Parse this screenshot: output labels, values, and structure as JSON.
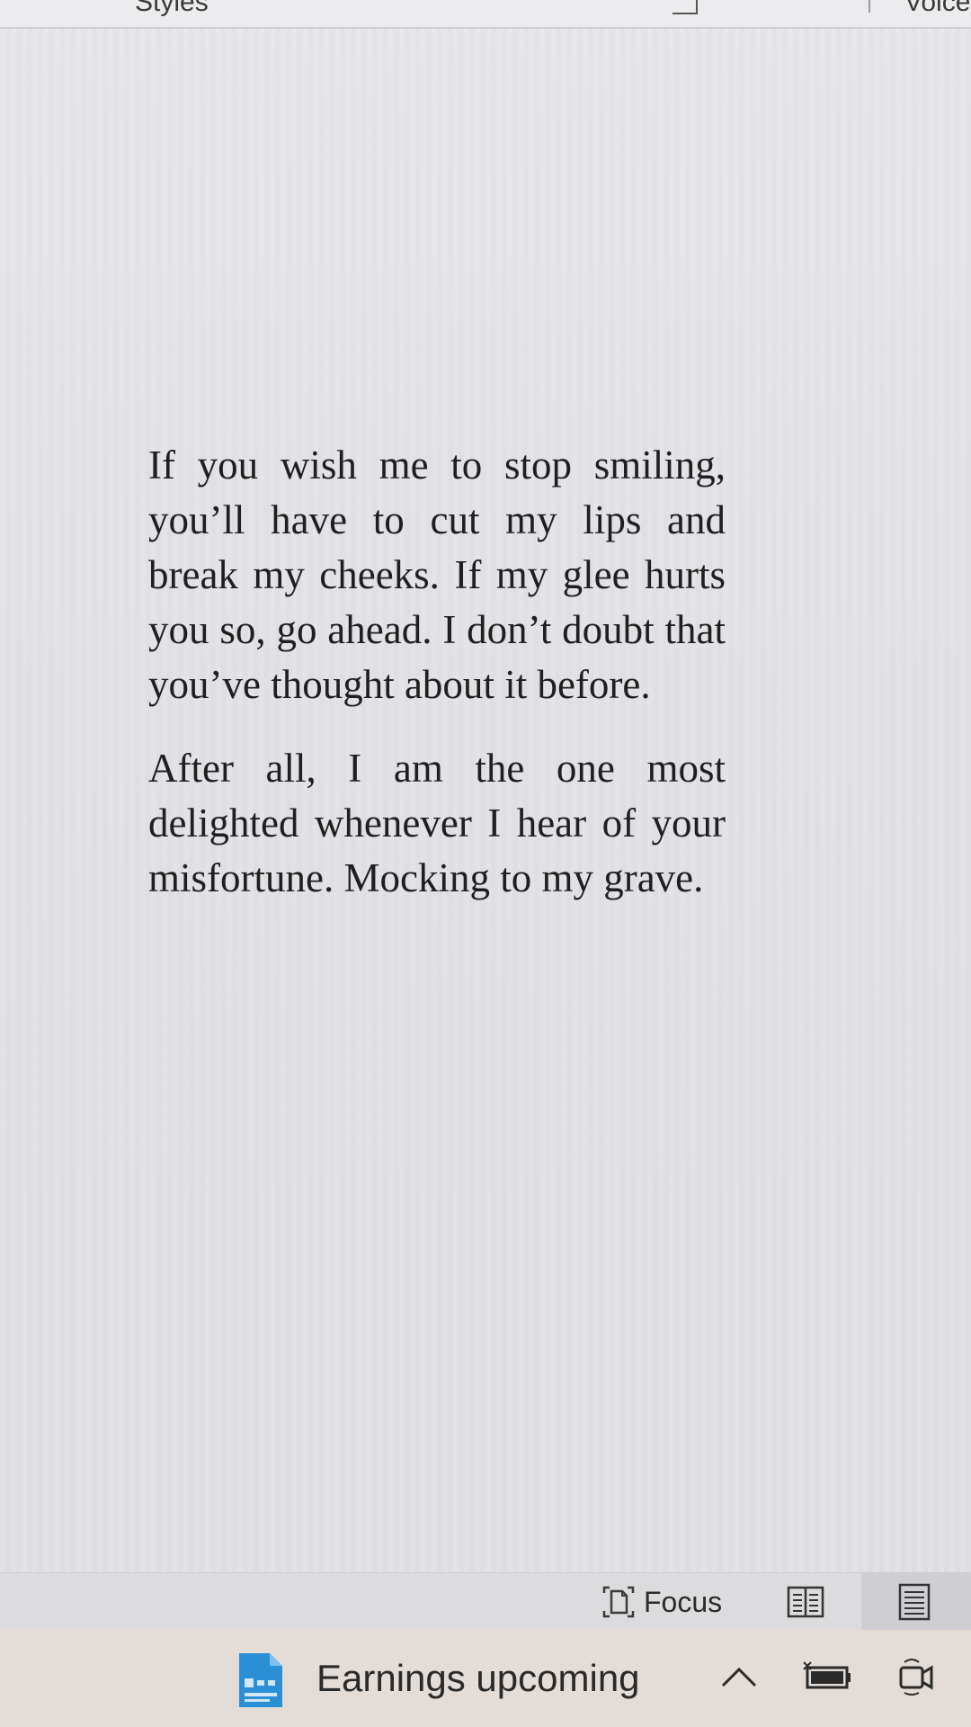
{
  "ribbon": {
    "styles_label": "Styles",
    "voice_label": "Voice"
  },
  "document": {
    "paragraphs": [
      "If you wish me to stop smiling, you’ll have to cut my lips and break my cheeks. If my glee hurts you so, go ahead. I don’t doubt that you’ve thought about it before.",
      "After all, I am the one most delighted whenever I hear of your misfortune. Mocking to my grave."
    ]
  },
  "statusbar": {
    "focus_label": "Focus",
    "focus_icon": "focus-icon",
    "read_mode_icon": "read-mode-icon",
    "print_layout_icon": "print-layout-icon"
  },
  "taskbar": {
    "news_text": "Earnings upcoming",
    "news_icon": "news-widget-icon",
    "chevron_icon": "chevron-up-icon",
    "battery_icon": "battery-icon",
    "meet_icon": "meet-now-icon"
  },
  "colors": {
    "page_bg": "#e2e2e6",
    "text": "#1f1f1f",
    "taskbar_bg": "#e4dcd6",
    "accent": "#2b8fd6"
  }
}
